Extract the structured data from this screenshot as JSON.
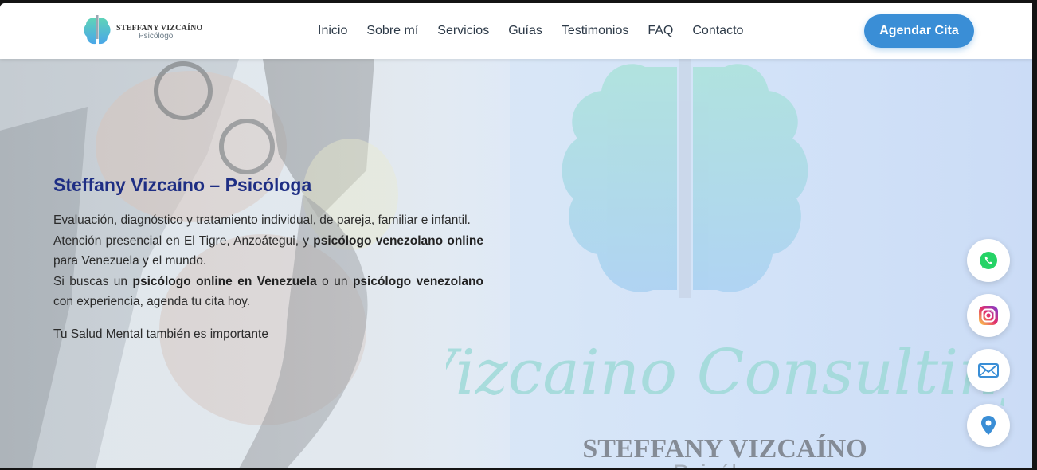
{
  "header": {
    "logo": {
      "name": "STEFFANY VIZCAÍNO",
      "subtitle": "Psicólogo"
    },
    "nav": [
      {
        "label": "Inicio"
      },
      {
        "label": "Sobre mí"
      },
      {
        "label": "Servicios"
      },
      {
        "label": "Guías"
      },
      {
        "label": "Testimonios"
      },
      {
        "label": "FAQ"
      },
      {
        "label": "Contacto"
      }
    ],
    "cta_label": "Agendar Cita"
  },
  "hero": {
    "title": "Steffany Vizcaíno – Psicóloga",
    "line1": "Evaluación, diagnóstico y tratamiento individual, de pareja, familiar e infantil.",
    "line2_pre": "Atención presencial en El Tigre, Anzoátegui, y ",
    "line2_bold": "psicólogo venezolano online",
    "line2_post": " para Venezuela y el mundo.",
    "line3_pre": "Si buscas un ",
    "line3_bold1": "psicólogo online en Venezuela",
    "line3_mid": " o un ",
    "line3_bold2": "psicólogo venezolano",
    "line3_post": " con experiencia, agenda tu cita hoy.",
    "tagline": "Tu Salud Mental también es importante"
  },
  "watermark": {
    "script_text": "Vizcaino Consulting",
    "name": "STEFFANY VIZCAÍNO",
    "subtitle": "Psicólogo"
  },
  "floating": [
    {
      "icon": "whatsapp-icon",
      "color": "#25d366"
    },
    {
      "icon": "instagram-icon",
      "color": "#d6249f"
    },
    {
      "icon": "mail-icon",
      "color": "#3a8ed6"
    },
    {
      "icon": "location-pin-icon",
      "color": "#3a8ed6"
    }
  ],
  "colors": {
    "accent": "#3a8ed6",
    "title": "#1e2e84"
  }
}
